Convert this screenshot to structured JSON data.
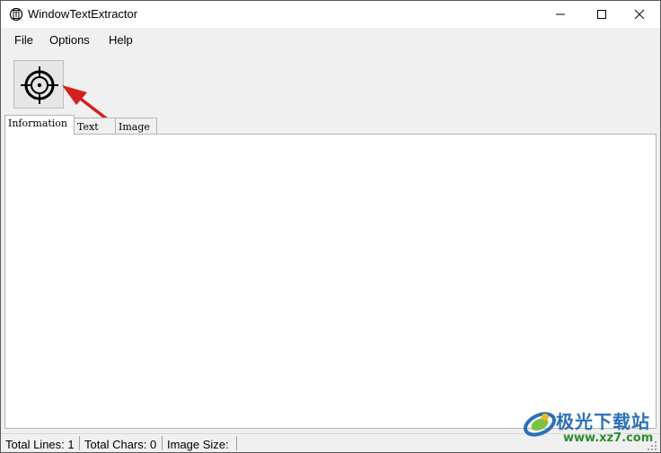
{
  "window": {
    "title": "WindowTextExtractor"
  },
  "menu": {
    "file": "File",
    "options": "Options",
    "help": "Help"
  },
  "toolbar": {
    "target_icon": "crosshair-icon"
  },
  "tabs": [
    {
      "label": "Information",
      "selected": true
    },
    {
      "label": "Text",
      "selected": false
    },
    {
      "label": "Image",
      "selected": false
    }
  ],
  "status": {
    "total_lines": "Total Lines: 1",
    "total_chars": "Total Chars: 0",
    "image_size": "Image Size:"
  },
  "watermark": {
    "title": "极光下载站",
    "url": "www.xz7.com"
  },
  "colors": {
    "annotation_arrow": "#d42020",
    "watermark_blue": "#2a6fb8",
    "watermark_green": "#2f8a2f"
  }
}
